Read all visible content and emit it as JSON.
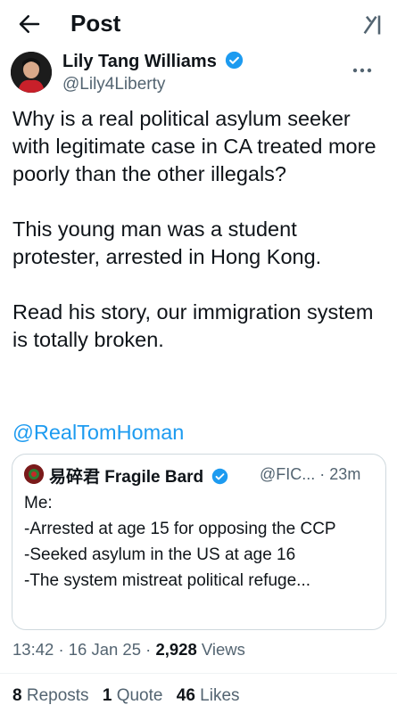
{
  "header": {
    "title": "Post"
  },
  "author": {
    "name": "Lily Tang Williams",
    "handle": "@Lily4Liberty"
  },
  "post": {
    "text": "Why is a real political asylum seeker with legitimate case in CA treated more poorly than the other illegals?\n\nThis young man was a student protester, arrested in Hong Kong.\n\nRead his story, our immigration system is totally broken.",
    "mention": "@RealTomHoman"
  },
  "quoted": {
    "name": "易碎君 Fragile Bard",
    "handle": "@FIC...",
    "time": "· 23m",
    "text": "Me:\n-Arrested at age 15 for opposing the CCP\n-Seeked asylum in the US at age 16\n-The system mistreat political refuge..."
  },
  "meta": {
    "time": "13:42",
    "date": "· 16 Jan 25 ·",
    "views_count": "2,928",
    "views_label": "Views"
  },
  "stats": {
    "reposts_count": "8",
    "reposts_label": "Reposts",
    "quotes_count": "1",
    "quotes_label": "Quote",
    "likes_count": "46",
    "likes_label": "Likes"
  },
  "colors": {
    "accent": "#1d9bf0",
    "secondary_text": "#536471",
    "text": "#0f1419"
  }
}
